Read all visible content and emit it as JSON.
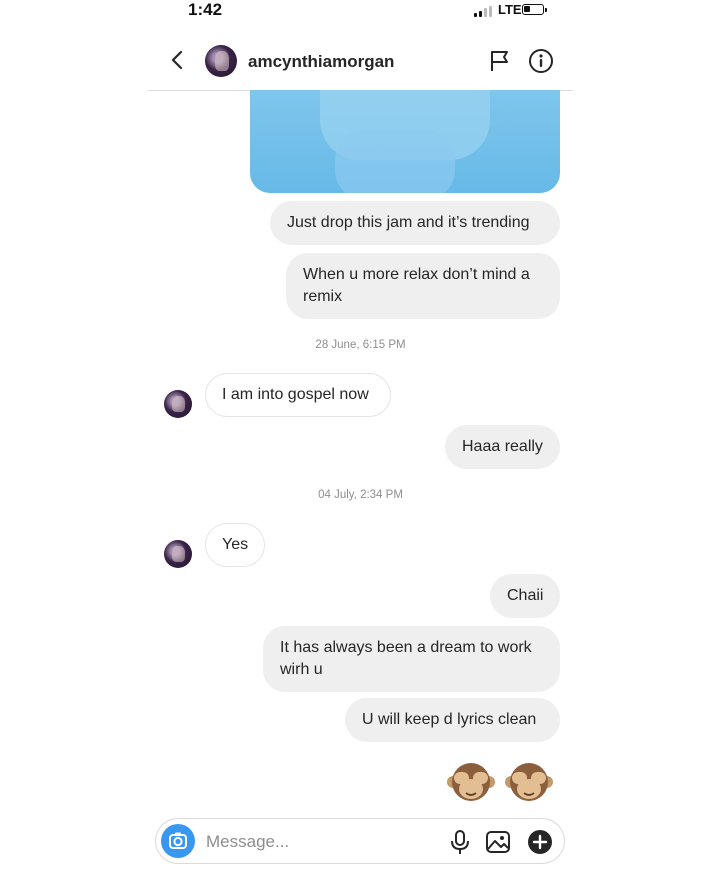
{
  "status_bar": {
    "time": "1:42",
    "network": "LTE"
  },
  "header": {
    "username": "amcynthiamorgan",
    "icons": [
      "back-chevron-icon",
      "flag-icon",
      "info-icon"
    ]
  },
  "messages": [
    {
      "side": "out",
      "text": "Just drop this jam and it’s trending"
    },
    {
      "side": "out",
      "text": "When u more relax don’t mind a remix"
    },
    {
      "type": "timestamp",
      "text": "28 June, 6:15 PM"
    },
    {
      "side": "in",
      "text": "I am into gospel now"
    },
    {
      "side": "out",
      "text": "Haaa really"
    },
    {
      "type": "timestamp",
      "text": "04 July, 2:34 PM"
    },
    {
      "side": "in",
      "text": "Yes"
    },
    {
      "side": "out",
      "text": "Chaii"
    },
    {
      "side": "out",
      "text": "It has always been a dream to work wirh u"
    },
    {
      "side": "out",
      "text": "U will keep d lyrics clean"
    },
    {
      "side": "out",
      "type": "emoji",
      "text": "🙈🙈"
    }
  ],
  "composer": {
    "placeholder": "Message...",
    "icons": [
      "camera-icon",
      "microphone-icon",
      "gallery-icon",
      "plus-icon"
    ]
  },
  "colors": {
    "accent": "#3897f0",
    "outgoing_bubble": "#efefef",
    "timestamp": "#8e8e8e"
  }
}
